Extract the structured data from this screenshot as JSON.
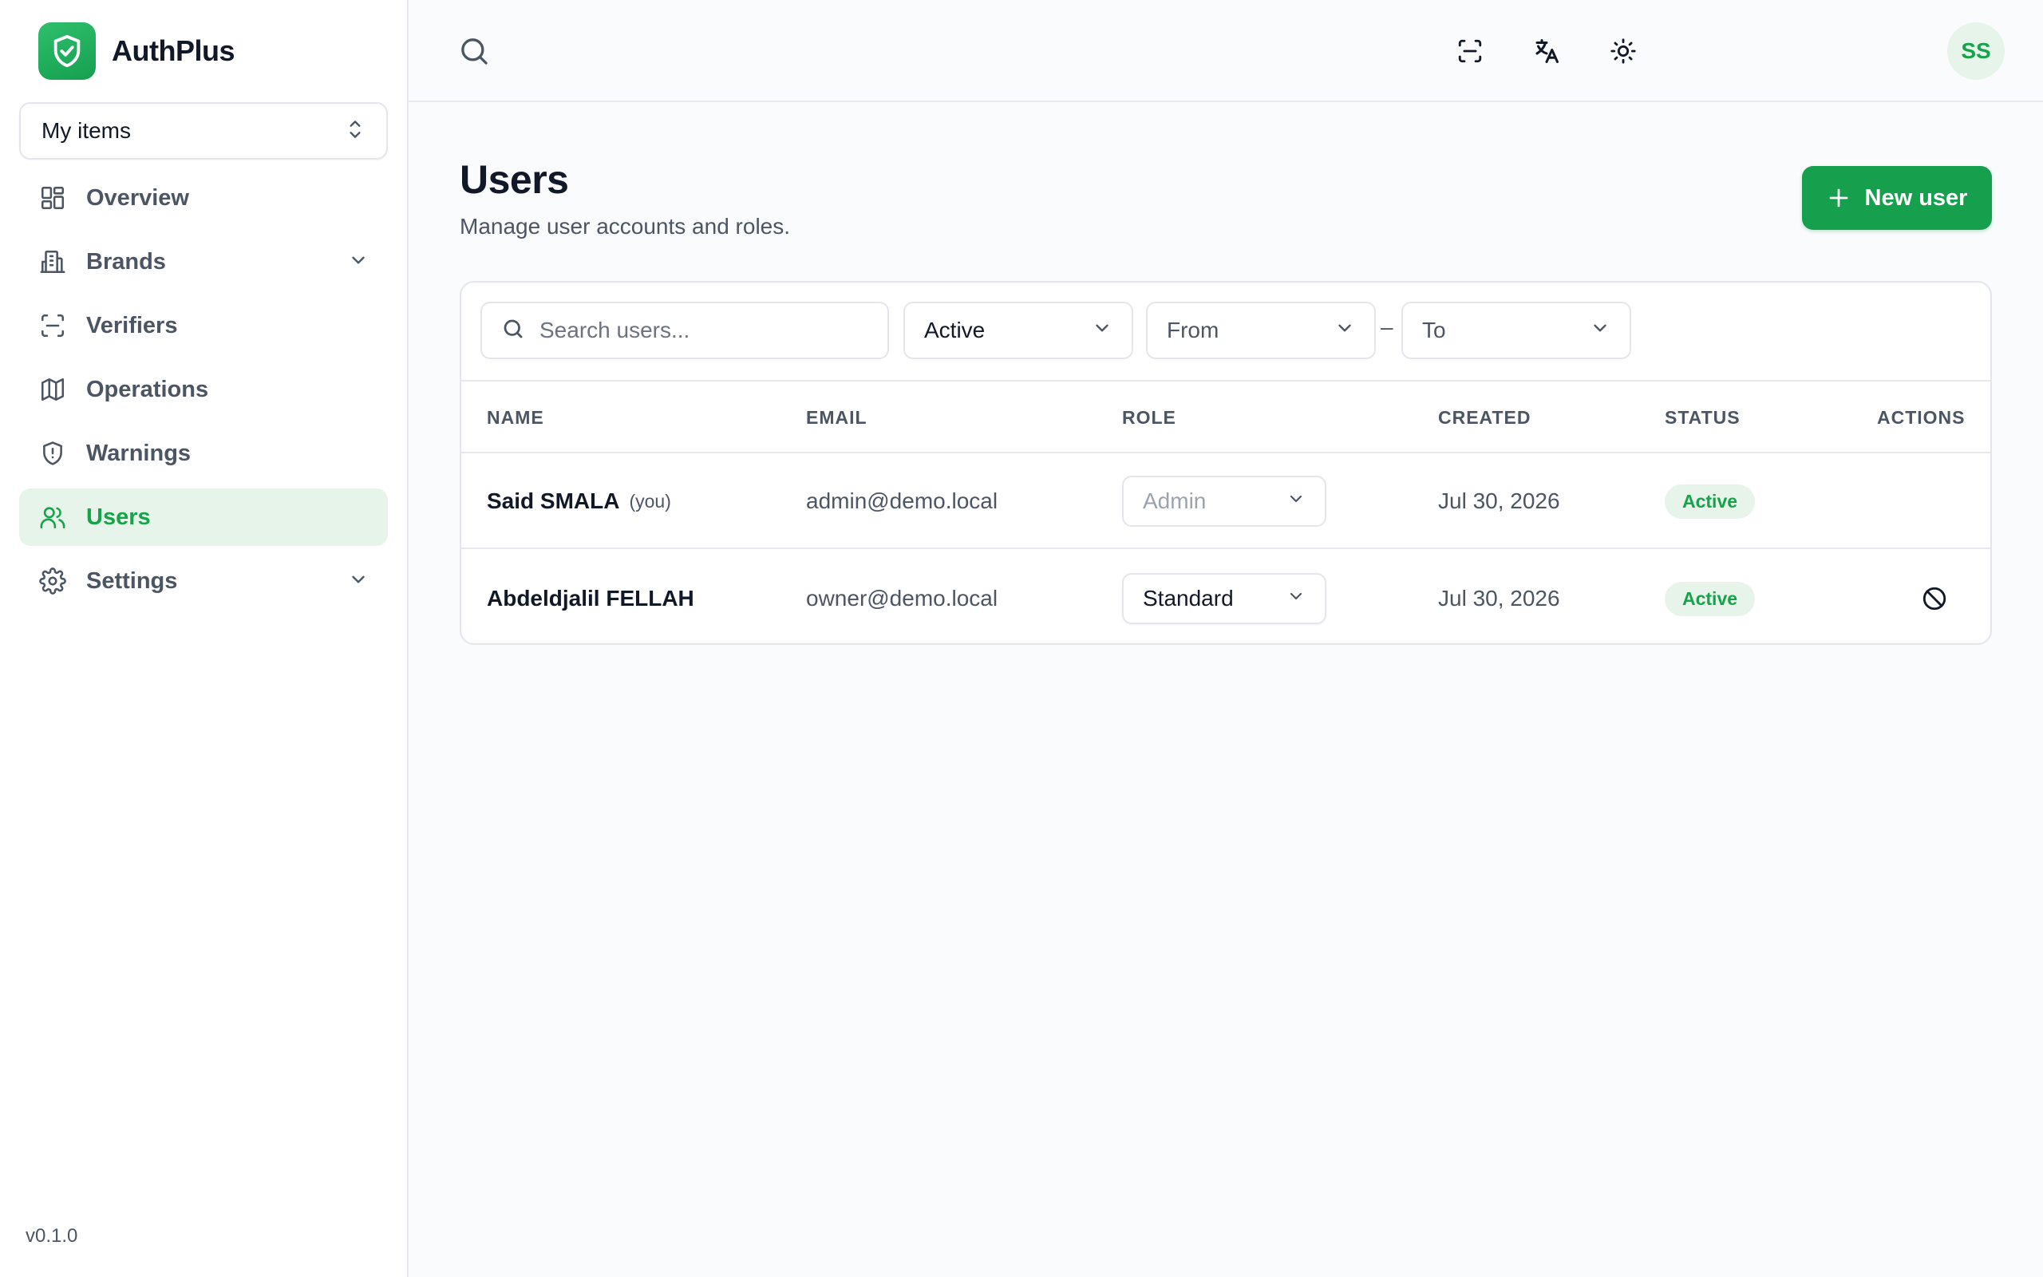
{
  "app": {
    "name": "AuthPlus",
    "version": "v0.1.0",
    "brand_color": "#16a34a"
  },
  "workspace": {
    "label": "My items"
  },
  "sidebar": {
    "items": [
      {
        "label": "Overview",
        "icon": "grid-icon",
        "active": false
      },
      {
        "label": "Brands",
        "icon": "building-icon",
        "active": false,
        "expandable": true
      },
      {
        "label": "Verifiers",
        "icon": "scan-icon",
        "active": false
      },
      {
        "label": "Operations",
        "icon": "map-icon",
        "active": false
      },
      {
        "label": "Warnings",
        "icon": "shield-alert-icon",
        "active": false
      },
      {
        "label": "Users",
        "icon": "users-icon",
        "active": true
      },
      {
        "label": "Settings",
        "icon": "gear-icon",
        "active": false,
        "expandable": true
      }
    ]
  },
  "topbar": {
    "avatar_initials": "SS",
    "icons": [
      "search-icon",
      "scan-icon",
      "translate-icon",
      "sun-icon"
    ]
  },
  "page": {
    "title": "Users",
    "subtitle": "Manage user accounts and roles.",
    "new_button_label": "New user"
  },
  "filters": {
    "search_placeholder": "Search users...",
    "status_value": "Active",
    "from_label": "From",
    "separator": "–",
    "to_label": "To"
  },
  "table": {
    "columns": [
      "NAME",
      "EMAIL",
      "ROLE",
      "CREATED",
      "STATUS",
      "ACTIONS"
    ],
    "rows": [
      {
        "name": "Said SMALA",
        "you_tag": "(you)",
        "email": "admin@demo.local",
        "role": "Admin",
        "role_editable": false,
        "created": "Jul 30, 2026",
        "status": "Active",
        "action": ""
      },
      {
        "name": "Abdeldjalil FELLAH",
        "you_tag": "",
        "email": "owner@demo.local",
        "role": "Standard",
        "role_editable": true,
        "created": "Jul 30, 2026",
        "status": "Active",
        "action": "ban-icon"
      }
    ]
  }
}
